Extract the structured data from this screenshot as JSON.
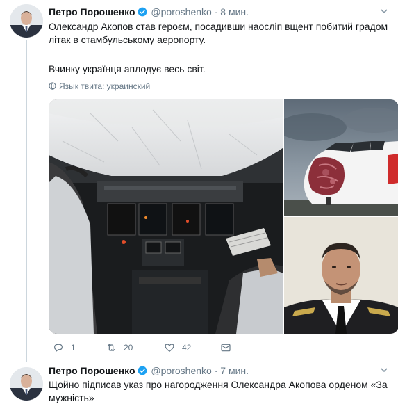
{
  "tweets": [
    {
      "name": "Петро Порошенко",
      "handle": "@poroshenko",
      "separator": "·",
      "time": "8 мин.",
      "text_line1": "Олександр Акопов став героєм, посадивши наосліп вщент побитий градом літак в стамбульському аеропорту.",
      "text_line2": "Вчинку українця аплодує весь світ.",
      "lang_note": "Язык твита: украинский",
      "actions": {
        "reply_count": "1",
        "retweet_count": "20",
        "like_count": "42"
      }
    },
    {
      "name": "Петро Порошенко",
      "handle": "@poroshenko",
      "separator": "·",
      "time": "7 мин.",
      "text_line1": "Щойно підписав указ про нагородження Олександра Акопова орденом «За мужність»"
    }
  ],
  "colors": {
    "verified": "#1da1f2",
    "secondary_text": "#657786",
    "thread_line": "#ccd6dd"
  },
  "icons": [
    "verified-icon",
    "chevron-down-icon",
    "globe-icon",
    "reply-icon",
    "retweet-icon",
    "like-icon",
    "message-icon"
  ]
}
